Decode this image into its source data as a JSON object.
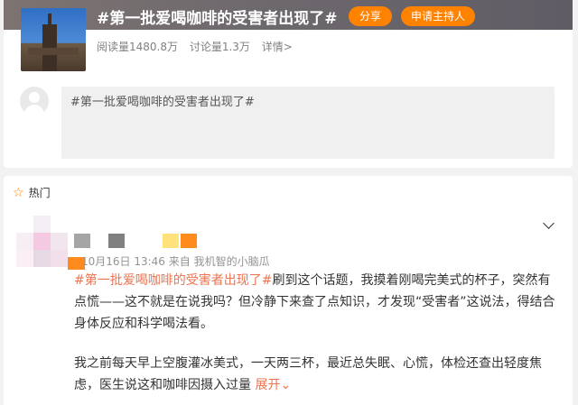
{
  "topic": {
    "title": "#第一批爱喝咖啡的受害者出现了#",
    "share_label": "分享",
    "host_label": "申请主持人",
    "reads": "阅读量1480.8万",
    "discussions": "讨论量1.3万",
    "details_label": "详情>"
  },
  "compose": {
    "value": "#第一批爱喝咖啡的受害者出现了#"
  },
  "feed": {
    "section_label": "热门",
    "post": {
      "meta": "10月16日 13:46  来自 我机智的小脑瓜",
      "tag": "#第一批爱喝咖啡的受害者出现了#",
      "text1": "刷到这个话题，我摸着刚喝完美式的杯子，突然有点慌——这不就是在说我吗？但冷静下来查了点知识，才发现“受害者”这说法，得结合身体反应和科学喝法看。",
      "text2": "我之前每天早上空腹灌冰美式，一天两三杯，最近总失眠、心慌，体检还查出轻度焦虑，医生说这和咖啡因摄入过量",
      "more_label": "展开"
    }
  },
  "colors": {
    "accent": "#ff8200",
    "link": "#eb7350"
  },
  "icons": [
    "default-avatar-icon",
    "star-icon",
    "chevron-down-icon"
  ]
}
